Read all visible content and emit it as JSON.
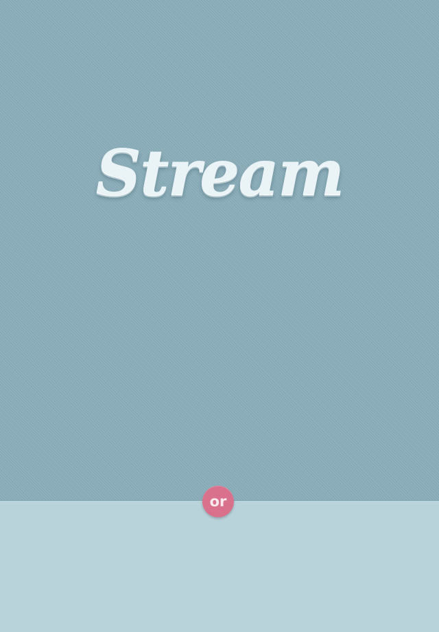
{
  "brand": {
    "logo_text": "Stream"
  },
  "separator": {
    "label": "or"
  },
  "colors": {
    "top_background": "#8cb0bc",
    "bottom_background": "#b9d3da",
    "badge": "#d9718c",
    "logo": "#eaf3f6"
  }
}
